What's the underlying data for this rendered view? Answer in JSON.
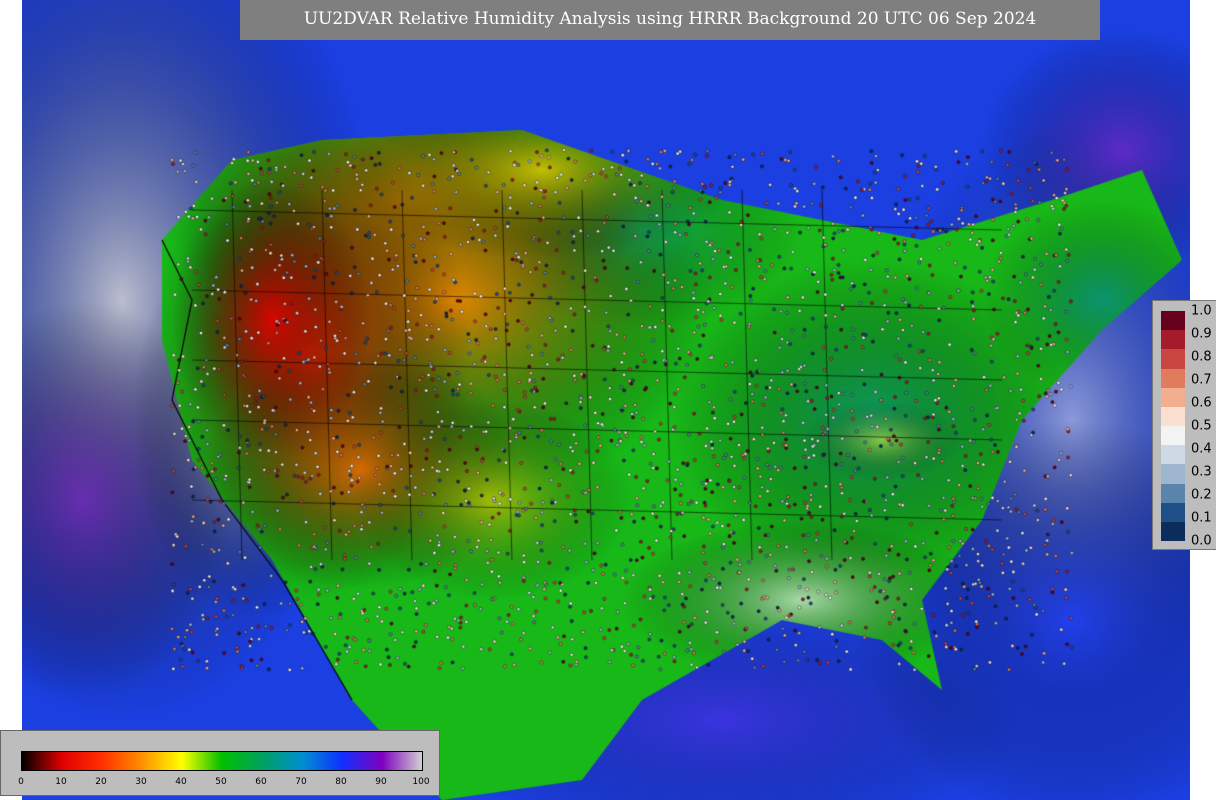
{
  "title": "UU2DVAR Relative Humidity Analysis using HRRR Background 20 UTC 06 Sep 2024",
  "rh_colorbar": {
    "ticks": [
      "0",
      "10",
      "20",
      "30",
      "40",
      "50",
      "60",
      "70",
      "80",
      "90",
      "100"
    ],
    "colors": [
      "#000000",
      "#e00000",
      "#ff3000",
      "#ff9000",
      "#ffff00",
      "#00c000",
      "#00a060",
      "#0090d0",
      "#1030ff",
      "#8000c0",
      "#d0d0d0"
    ]
  },
  "obs_colorbar": {
    "labels": [
      "1.0",
      "0.9",
      "0.8",
      "0.7",
      "0.6",
      "0.5",
      "0.4",
      "0.3",
      "0.2",
      "0.1",
      "0.0"
    ],
    "colors": [
      "#67001f",
      "#a41c2c",
      "#c94641",
      "#e07b5d",
      "#f2ae8e",
      "#fbe0d2",
      "#f3f3f3",
      "#cfd9e6",
      "#9fb6cf",
      "#5b84ab",
      "#1e4f86",
      "#0d2c5e"
    ]
  }
}
